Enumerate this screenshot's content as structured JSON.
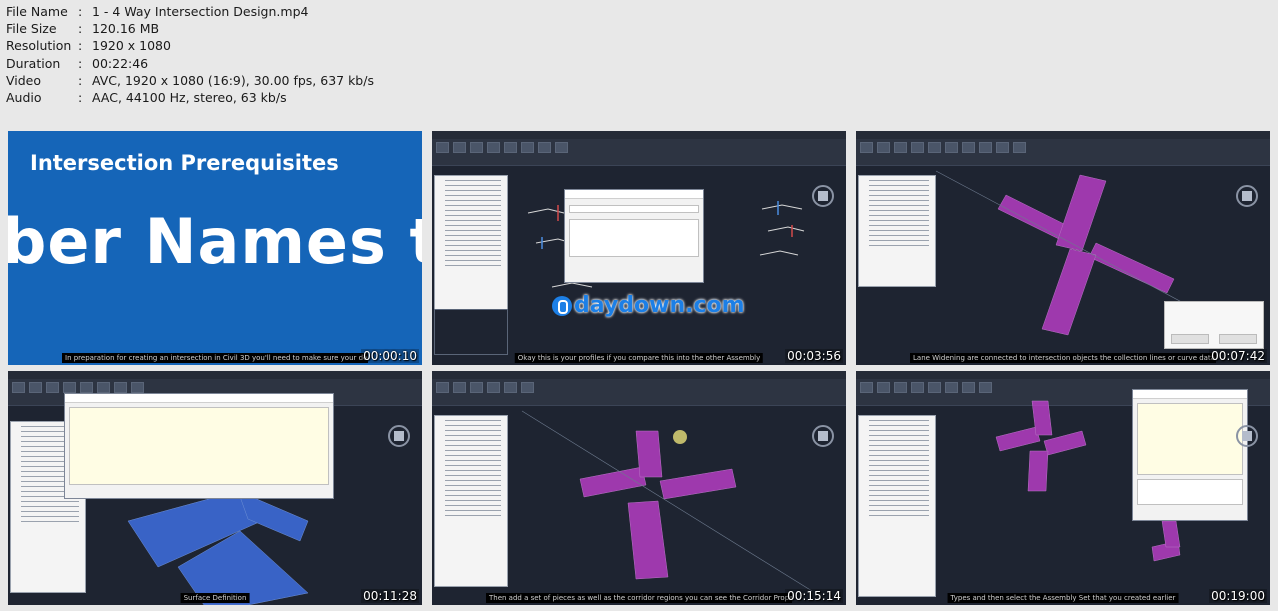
{
  "file_info": [
    {
      "label": "File Name",
      "sep": ":",
      "value": "1 - 4 Way Intersection Design.mp4"
    },
    {
      "label": "File Size",
      "sep": ":",
      "value": "120.16 MB"
    },
    {
      "label": "Resolution",
      "sep": ":",
      "value": "1920 x 1080"
    },
    {
      "label": "Duration",
      "sep": ":",
      "value": "00:22:46"
    },
    {
      "label": "Video",
      "sep": ":",
      "value": "AVC, 1920 x 1080 (16:9), 30.00 fps, 637 kb/s"
    },
    {
      "label": "Audio",
      "sep": ":",
      "value": "AAC, 44100 Hz, stereo, 63 kb/s"
    }
  ],
  "thumbnails": [
    {
      "timestamp": "00:00:10",
      "slide_title": "Intersection Prerequisites",
      "slide_big": "ber Names to",
      "caption": "In preparation for creating an intersection in Civil 3D you'll need to make sure your design meets"
    },
    {
      "timestamp": "00:03:56",
      "caption": "Okay this is your profiles if you compare this into the other Assembly",
      "watermark": "daydown.com"
    },
    {
      "timestamp": "00:07:42",
      "caption": "Lane Widening are connected to intersection objects the collection lines or curve data on"
    },
    {
      "timestamp": "00:11:28",
      "caption": "Surface Definition"
    },
    {
      "timestamp": "00:15:14",
      "caption": "Then add a set of pieces as well as the corridor regions you can see the Corridor Properties"
    },
    {
      "timestamp": "00:19:00",
      "caption": "Types and then select the Assembly Set that you created earlier"
    }
  ],
  "colors": {
    "slide_blue": "#1565b8",
    "cad_bg": "#1e2431",
    "corridor_magenta": "#c23fd0",
    "corridor_blue": "#3e6fe0",
    "watermark_blue": "#1c7fe6"
  }
}
